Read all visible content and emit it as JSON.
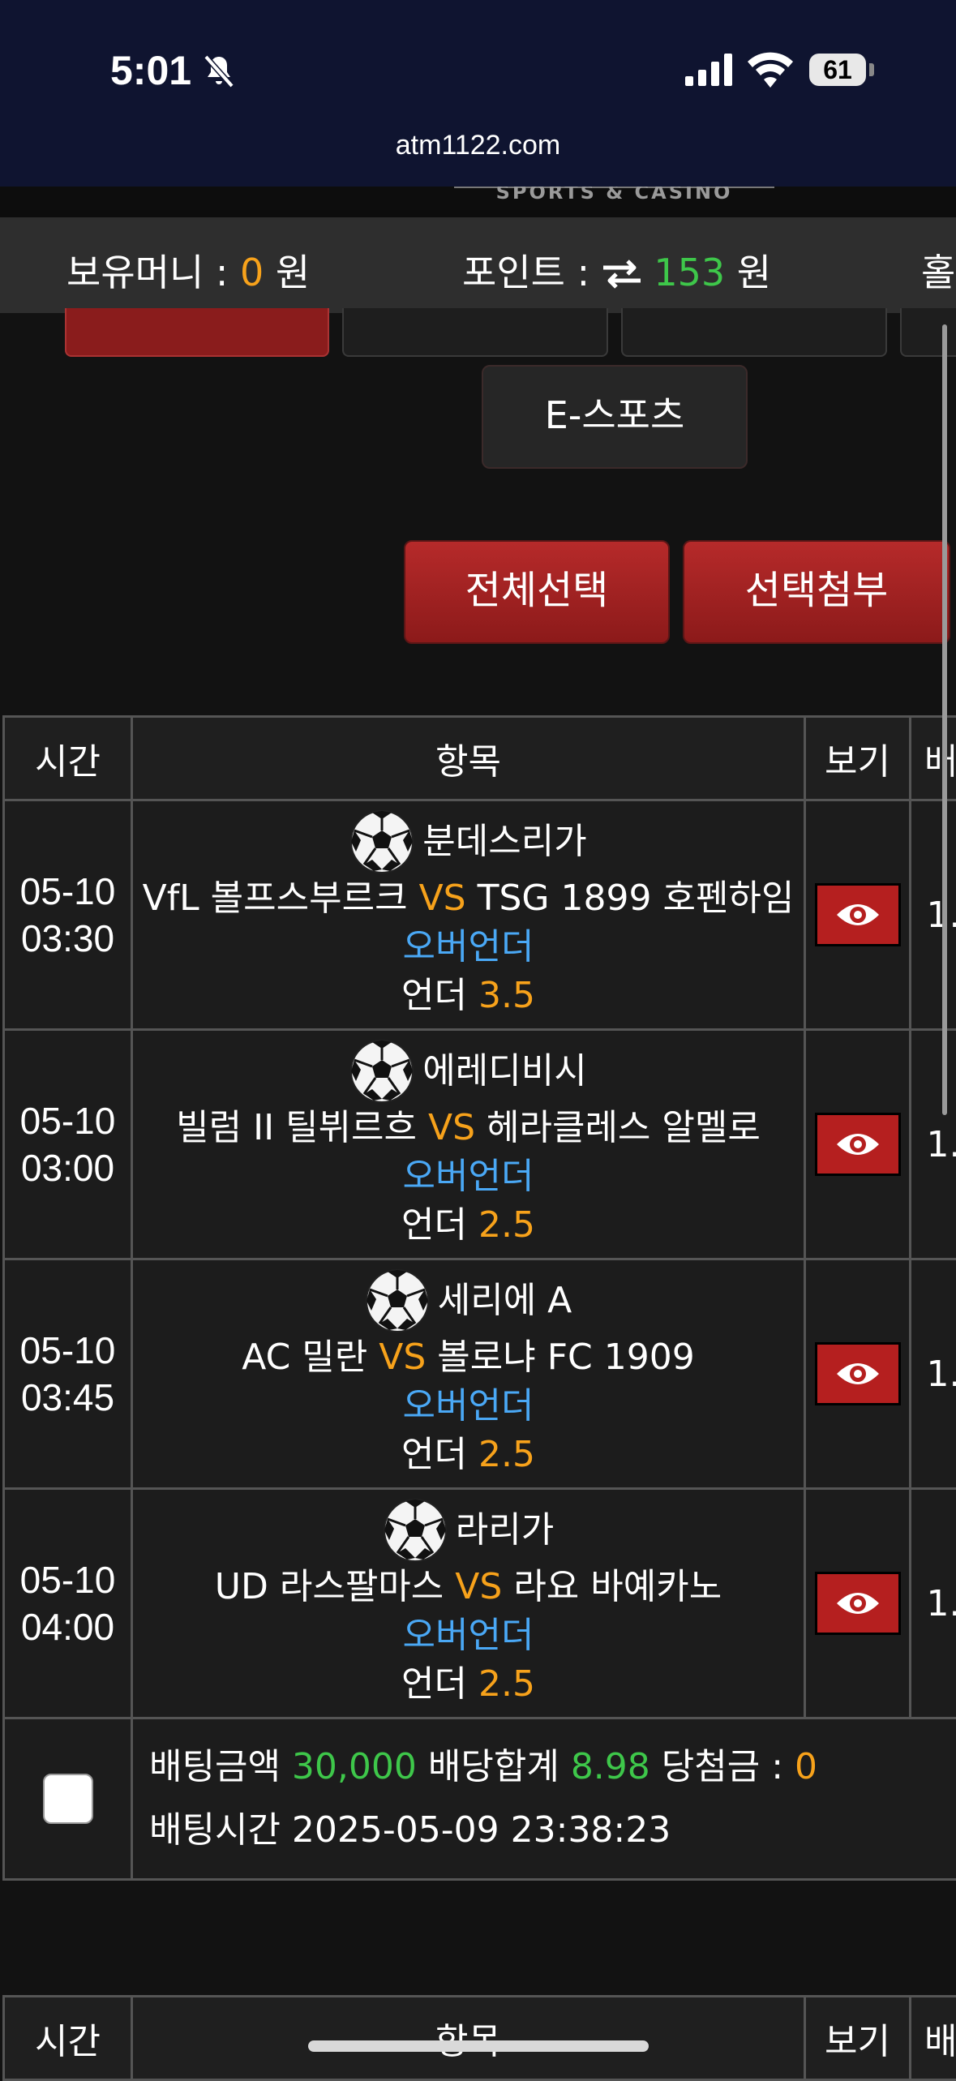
{
  "status_bar": {
    "time": "5:01",
    "battery": "61",
    "url": "atm1122.com"
  },
  "logo": {
    "text": "SPORTS & CASINO"
  },
  "info_bar": {
    "money_label": "보유머니 : ",
    "money_value": "0",
    "money_unit": " 원",
    "points_label": "포인트 : ",
    "points_value": "153",
    "points_unit": " 원",
    "extra_label": "홀"
  },
  "nav": {
    "esports": "E-스포츠"
  },
  "actions": {
    "select_all": "전체선택",
    "attach_selected": "선택첨부"
  },
  "table": {
    "headers": {
      "time": "시간",
      "item": "항목",
      "view": "보기",
      "odds": "배"
    },
    "vs": "VS",
    "rows": [
      {
        "date": "05-10",
        "time": "03:30",
        "league": "분데스리가",
        "home": "VfL 볼프스부르크",
        "away": "TSG 1899 호펜하임",
        "market": "오버언더",
        "pick": "언더",
        "line": "3.5",
        "odds": "1."
      },
      {
        "date": "05-10",
        "time": "03:00",
        "league": "에레디비시",
        "home": "빌럼 II 틸뷔르흐",
        "away": "헤라클레스 알멜로",
        "market": "오버언더",
        "pick": "언더",
        "line": "2.5",
        "odds": "1."
      },
      {
        "date": "05-10",
        "time": "03:45",
        "league": "세리에 A",
        "home": "AC 밀란",
        "away": "볼로냐 FC 1909",
        "market": "오버언더",
        "pick": "언더",
        "line": "2.5",
        "odds": "1."
      },
      {
        "date": "05-10",
        "time": "04:00",
        "league": "라리가",
        "home": "UD 라스팔마스",
        "away": "라요 바예카노",
        "market": "오버언더",
        "pick": "언더",
        "line": "2.5",
        "odds": "1."
      }
    ],
    "summary": {
      "bet_amount_label": "배팅금액",
      "bet_amount": "30,000",
      "total_odds_label": "배당합계",
      "total_odds": "8.98",
      "win_label": "당첨금 :",
      "win_amount": "0",
      "bet_time_label": "배팅시간",
      "bet_time": "2025-05-09 23:38:23"
    }
  },
  "table2": {
    "headers": {
      "time": "시간",
      "item": "항목",
      "view": "보기",
      "odds": "배"
    }
  }
}
